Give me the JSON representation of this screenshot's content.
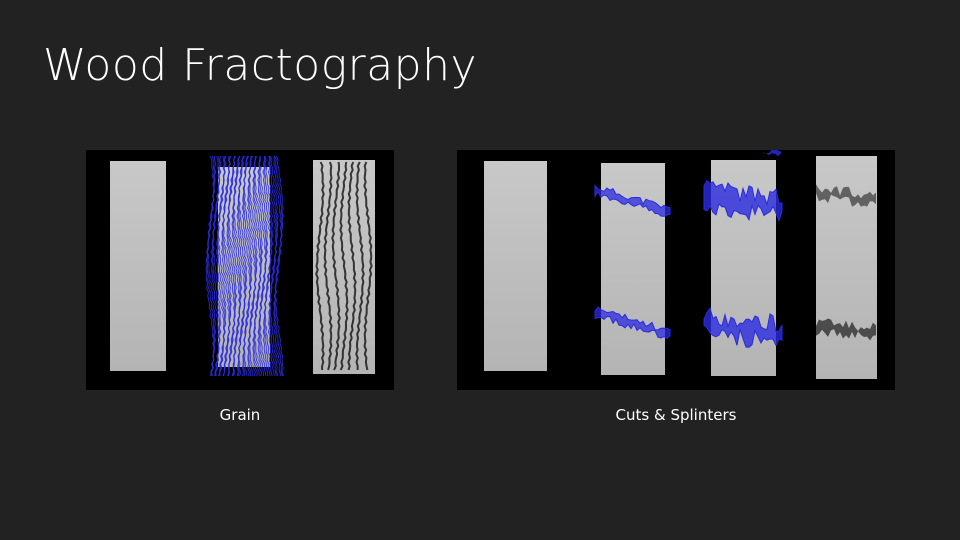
{
  "slide": {
    "title": "Wood Fractography",
    "background": "#222222"
  },
  "figures": [
    {
      "caption": "Grain"
    },
    {
      "caption": "Cuts & Splinters"
    }
  ],
  "colors": {
    "wireframe": "#2a2ae0",
    "board": "#bdbdbd",
    "crack": "#111111"
  }
}
